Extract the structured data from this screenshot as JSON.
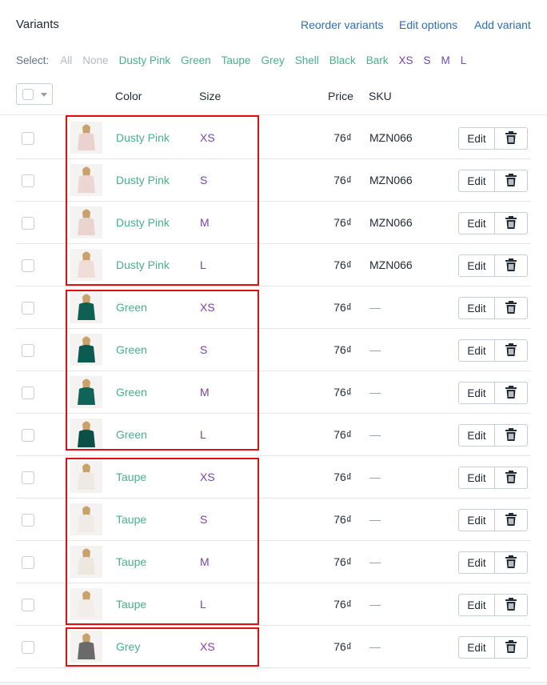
{
  "header": {
    "title": "Variants",
    "reorder_label": "Reorder variants",
    "edit_options_label": "Edit options",
    "add_variant_label": "Add variant"
  },
  "select": {
    "label": "Select:",
    "all": "All",
    "none": "None",
    "colors": [
      "Dusty Pink",
      "Green",
      "Taupe",
      "Grey",
      "Shell",
      "Black",
      "Bark"
    ],
    "sizes": [
      "XS",
      "S",
      "M",
      "L"
    ]
  },
  "table": {
    "headers": {
      "color": "Color",
      "size": "Size",
      "price": "Price",
      "sku": "SKU"
    },
    "edit_label": "Edit",
    "rows": [
      {
        "color": "Dusty Pink",
        "size": "XS",
        "price": "76₫",
        "sku": "MZN066",
        "swatch": "#e9d2cf",
        "icon": "product-thumbnail-icon"
      },
      {
        "color": "Dusty Pink",
        "size": "S",
        "price": "76₫",
        "sku": "MZN066",
        "swatch": "#ecd6d2",
        "icon": "product-thumbnail-icon"
      },
      {
        "color": "Dusty Pink",
        "size": "M",
        "price": "76₫",
        "sku": "MZN066",
        "swatch": "#ead4d0",
        "icon": "product-thumbnail-icon"
      },
      {
        "color": "Dusty Pink",
        "size": "L",
        "price": "76₫",
        "sku": "MZN066",
        "swatch": "#f0dcd8",
        "icon": "product-thumbnail-icon"
      },
      {
        "color": "Green",
        "size": "XS",
        "price": "76₫",
        "sku": "—",
        "swatch": "#0f5f55",
        "icon": "product-thumbnail-icon"
      },
      {
        "color": "Green",
        "size": "S",
        "price": "76₫",
        "sku": "—",
        "swatch": "#0d5a50",
        "icon": "product-thumbnail-icon"
      },
      {
        "color": "Green",
        "size": "M",
        "price": "76₫",
        "sku": "—",
        "swatch": "#106457",
        "icon": "product-thumbnail-icon"
      },
      {
        "color": "Green",
        "size": "L",
        "price": "76₫",
        "sku": "—",
        "swatch": "#0b4f47",
        "icon": "product-thumbnail-icon"
      },
      {
        "color": "Taupe",
        "size": "XS",
        "price": "76₫",
        "sku": "—",
        "swatch": "#efe9e3",
        "icon": "product-thumbnail-icon"
      },
      {
        "color": "Taupe",
        "size": "S",
        "price": "76₫",
        "sku": "—",
        "swatch": "#f1ebe6",
        "icon": "product-thumbnail-icon"
      },
      {
        "color": "Taupe",
        "size": "M",
        "price": "76₫",
        "sku": "—",
        "swatch": "#eee7e0",
        "icon": "product-thumbnail-icon"
      },
      {
        "color": "Taupe",
        "size": "L",
        "price": "76₫",
        "sku": "—",
        "swatch": "#f2ede8",
        "icon": "product-thumbnail-icon"
      },
      {
        "color": "Grey",
        "size": "XS",
        "price": "76₫",
        "sku": "—",
        "swatch": "#6a6a6a",
        "icon": "product-thumbnail-icon"
      }
    ]
  },
  "colors": {
    "link": "#2f6fb0",
    "color_value": "#47b08a",
    "size_value": "#7a41b2",
    "highlight": "#e01010"
  }
}
